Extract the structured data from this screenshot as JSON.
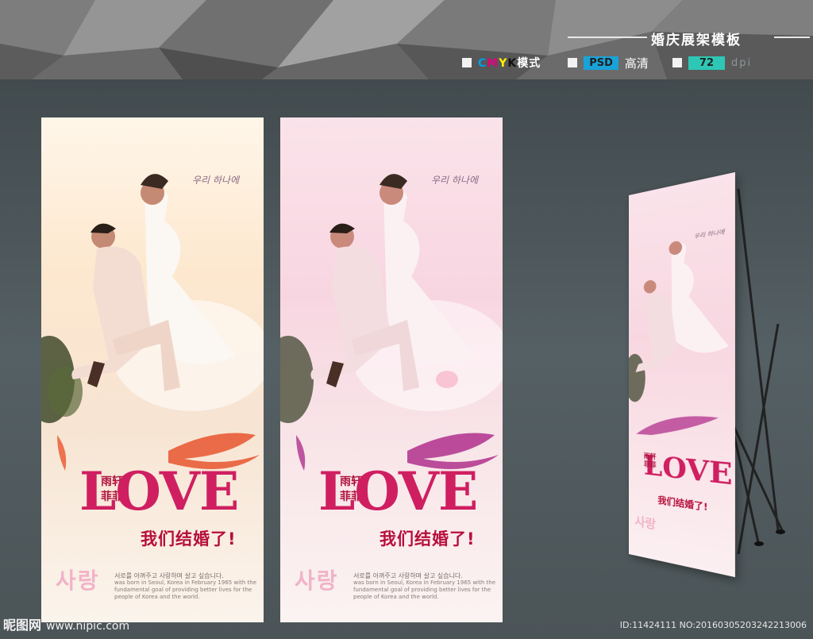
{
  "header": {
    "title": "婚庆展架模板",
    "mode_label": "模式",
    "cmyk_letters": [
      "C",
      "M",
      "Y",
      "K"
    ],
    "cmyk_colors": [
      "#00a0e9",
      "#e4007f",
      "#fff100",
      "#111111"
    ],
    "format_tag": "PSD",
    "format_label": "高清",
    "dpi_value": "72",
    "dpi_label": "dpi"
  },
  "poster": {
    "korean_script": "우리 하나에",
    "love": "LOVE",
    "brand": [
      "雨轩",
      "菲菲"
    ],
    "slogan": "我们结婚了!",
    "korean_large": "사랑",
    "fine_print_main": "서로를 아껴주고 사랑하며 살고 싶습니다.",
    "fine_print_extra": "was born in Seoul, Korea in February 1965 with the fundamental goal of providing better lives for the people of Korea and the world."
  },
  "variants": [
    {
      "name": "warm-orange",
      "accent": "#e8552e"
    },
    {
      "name": "pink-purple",
      "accent": "#b0308c"
    }
  ],
  "footer": {
    "logo": "昵图网",
    "site": "www.nipic.com",
    "id_text": "ID:11424111 NO:20160305203242213006"
  }
}
